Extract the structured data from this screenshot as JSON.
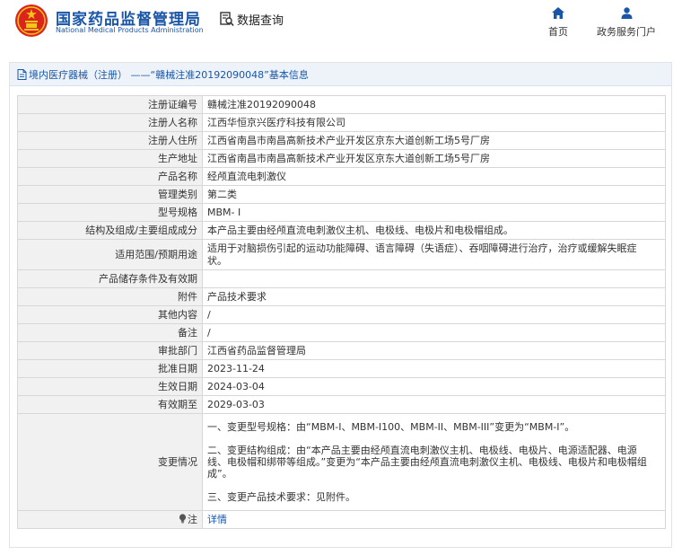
{
  "header": {
    "org_name_cn": "国家药品监督管理局",
    "org_name_en": "National Medical Products Administration",
    "query_label": "数据查询",
    "nav": [
      {
        "label": "首页",
        "icon": "home-icon"
      },
      {
        "label": "政务服务门户",
        "icon": "user-icon"
      }
    ]
  },
  "panel": {
    "title": "境内医疗器械（注册） ——“赣械注准20192090048”基本信息"
  },
  "fields": [
    {
      "label": "注册证编号",
      "value": "赣械注准20192090048"
    },
    {
      "label": "注册人名称",
      "value": "江西华恒京兴医疗科技有限公司"
    },
    {
      "label": "注册人住所",
      "value": "江西省南昌市南昌高新技术产业开发区京东大道创新工场5号厂房"
    },
    {
      "label": "生产地址",
      "value": "江西省南昌市南昌高新技术产业开发区京东大道创新工场5号厂房"
    },
    {
      "label": "产品名称",
      "value": "经颅直流电刺激仪"
    },
    {
      "label": "管理类别",
      "value": "第二类"
    },
    {
      "label": "型号规格",
      "value": "MBM- I"
    },
    {
      "label": "结构及组成/主要组成成分",
      "value": "本产品主要由经颅直流电刺激仪主机、电极线、电极片和电极帽组成。"
    },
    {
      "label": "适用范围/预期用途",
      "value": "适用于对脑损伤引起的运动功能障碍、语言障碍（失语症）、吞咽障碍进行治疗，治疗或缓解失眠症状。"
    },
    {
      "label": "产品储存条件及有效期",
      "value": ""
    },
    {
      "label": "附件",
      "value": "产品技术要求"
    },
    {
      "label": "其他内容",
      "value": "/"
    },
    {
      "label": "备注",
      "value": "/"
    },
    {
      "label": "审批部门",
      "value": "江西省药品监督管理局"
    },
    {
      "label": "批准日期",
      "value": "2023-11-24"
    },
    {
      "label": "生效日期",
      "value": "2024-03-04"
    },
    {
      "label": "有效期至",
      "value": "2029-03-03"
    }
  ],
  "changes": {
    "label": "变更情况",
    "items": [
      "一、变更型号规格：由“MBM-I、MBM-I100、MBM-II、MBM-III”变更为“MBM-I”。",
      "二、变更结构组成：由“本产品主要由经颅直流电刺激仪主机、电极线、电极片、电源适配器、电源线、电极帽和绑带等组成。”变更为“本产品主要由经颅直流电刺激仪主机、电极线、电极片和电极帽组成”。",
      "三、变更产品技术要求：见附件。"
    ]
  },
  "note": {
    "label": "注",
    "link_text": "详情"
  },
  "colors": {
    "brand_blue": "#1a56a8",
    "emblem_red": "#d9251c",
    "emblem_gold": "#f5c518",
    "label_bg": "#f1f1f1",
    "titlebar_bg": "#eef3f9"
  }
}
